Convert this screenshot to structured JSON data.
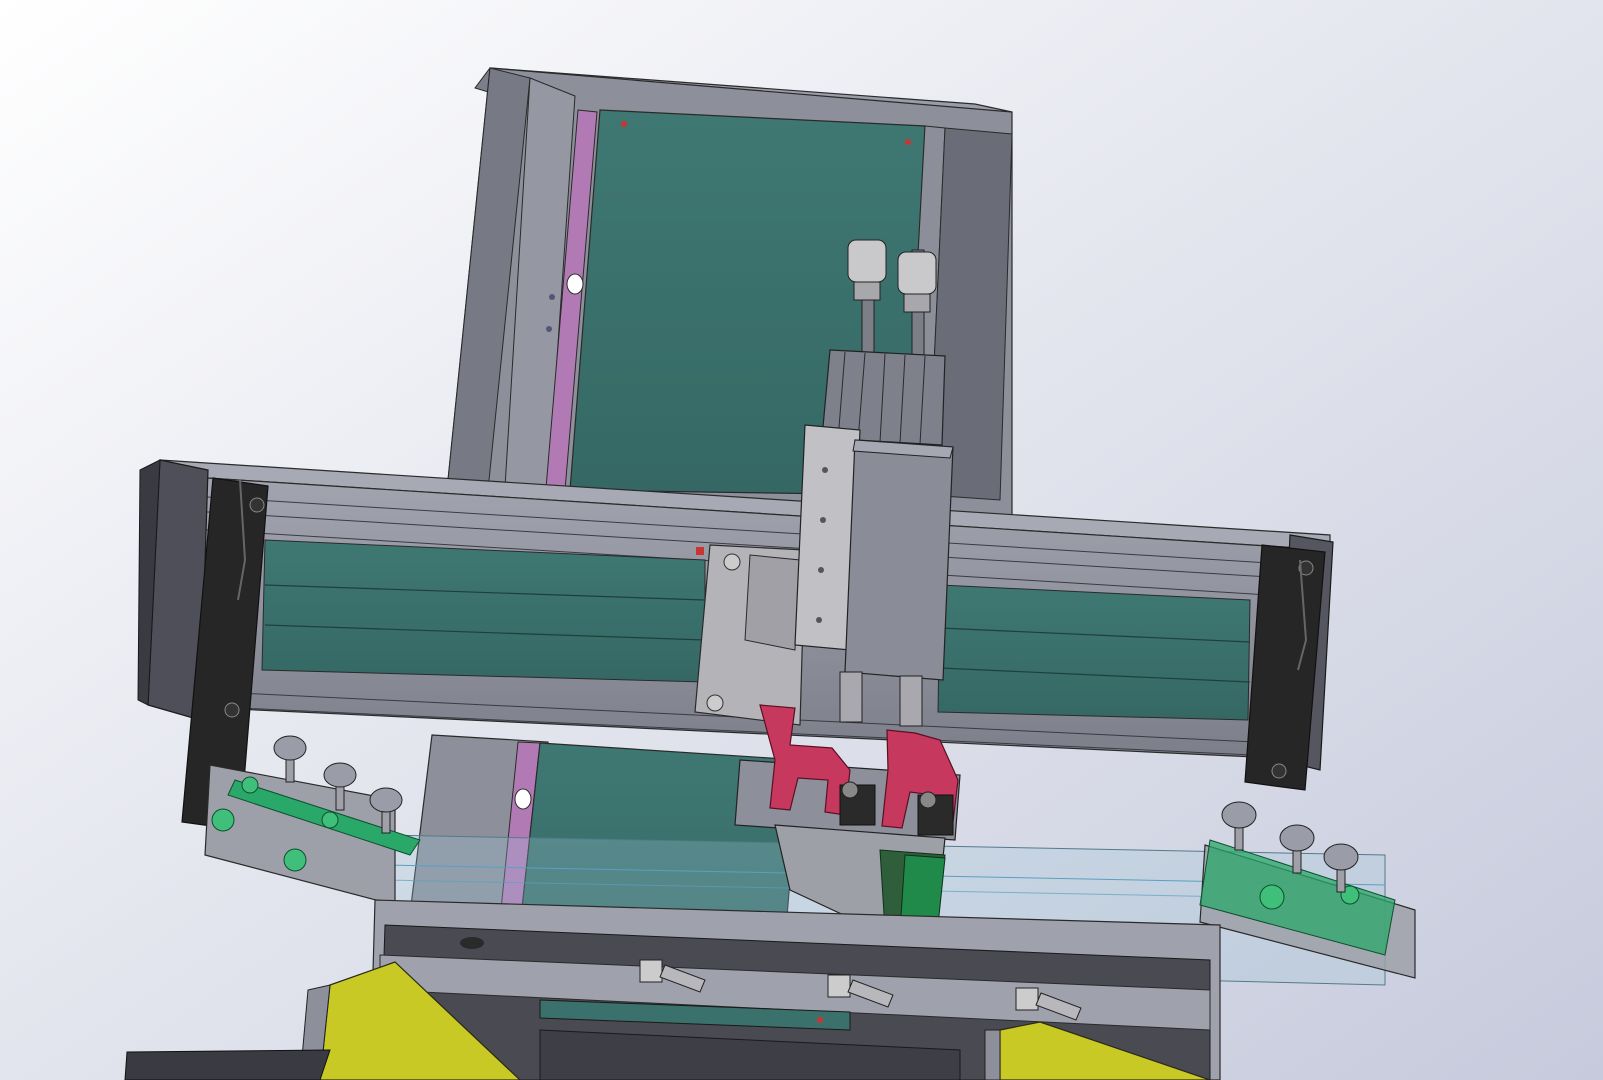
{
  "viewport": {
    "background_top": "#ffffff",
    "background_bottom": "#c9cde0"
  },
  "colors": {
    "frame_grey": "#8e909c",
    "frame_dark": "#5d5f6b",
    "frame_light": "#a9abb6",
    "panel_teal": "#3b716c",
    "panel_teal_dark": "#2f5f5a",
    "pink_strip": "#b27ab4",
    "clamp_black": "#262626",
    "bracket_green": "#2aa86a",
    "red_bracket": "#c6385e",
    "carriage_light": "#b4b4b8",
    "yellow_base": "#c9c926",
    "glass": "#9fc4d6"
  },
  "icons": [
    "vertical-column",
    "horizontal-gantry-beam",
    "carriage-plate",
    "cylinder-actuator",
    "squeegee-holder",
    "left-clamp-arm",
    "right-clamp-arm",
    "glass-plate",
    "base-table",
    "yellow-side-rails"
  ]
}
